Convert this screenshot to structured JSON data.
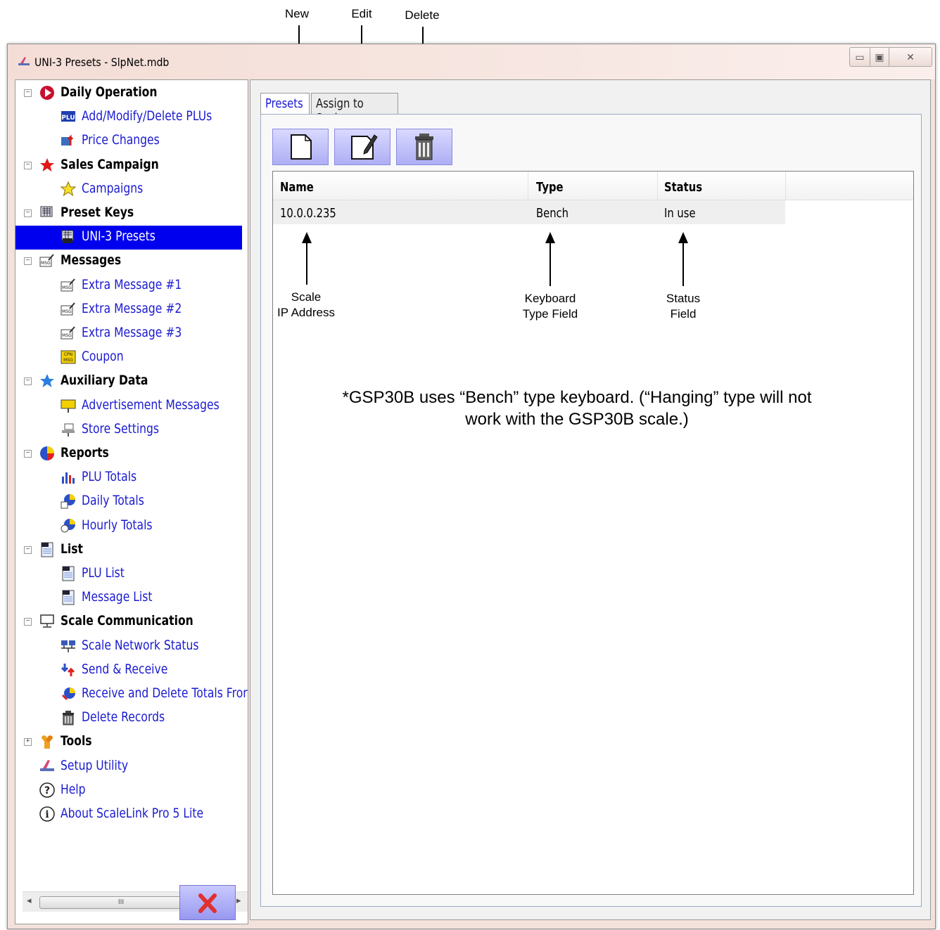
{
  "callouts": {
    "new": "New",
    "edit": "Edit",
    "delete": "Delete",
    "scale_ip_line1": "Scale",
    "scale_ip_line2": "IP Address",
    "keyboard_line1": "Keyboard",
    "keyboard_line2": "Type Field",
    "status_line1": "Status",
    "status_line2": "Field"
  },
  "window": {
    "title": "UNI-3 Presets - SlpNet.mdb",
    "min_glyph": "▭",
    "max_glyph": "▣",
    "close_glyph": "✕"
  },
  "tree": [
    {
      "level": 0,
      "label": "Daily Operation",
      "icon": "play-icon",
      "expander": "⊟"
    },
    {
      "level": 1,
      "label": "Add/Modify/Delete PLUs",
      "icon": "plu-icon"
    },
    {
      "level": 1,
      "label": "Price Changes",
      "icon": "price-change-icon"
    },
    {
      "level": 0,
      "label": "Sales Campaign",
      "icon": "star-red-icon",
      "expander": "⊟"
    },
    {
      "level": 1,
      "label": "Campaigns",
      "icon": "star-yellow-icon"
    },
    {
      "level": 0,
      "label": "Preset Keys",
      "icon": "preset-keys-icon",
      "expander": "⊟"
    },
    {
      "level": 1,
      "label": "UNI-3 Presets",
      "icon": "uni3-presets-icon",
      "selected": true
    },
    {
      "level": 0,
      "label": "Messages",
      "icon": "message-icon",
      "expander": "⊟"
    },
    {
      "level": 1,
      "label": "Extra Message #1",
      "icon": "message-icon"
    },
    {
      "level": 1,
      "label": "Extra Message #2",
      "icon": "message-icon"
    },
    {
      "level": 1,
      "label": "Extra Message #3",
      "icon": "message-icon"
    },
    {
      "level": 1,
      "label": "Coupon",
      "icon": "coupon-icon"
    },
    {
      "level": 0,
      "label": "Auxiliary Data",
      "icon": "star-blue-icon",
      "expander": "⊟"
    },
    {
      "level": 1,
      "label": "Advertisement Messages",
      "icon": "advertisement-icon"
    },
    {
      "level": 1,
      "label": "Store Settings",
      "icon": "store-settings-icon"
    },
    {
      "level": 0,
      "label": "Reports",
      "icon": "pie-chart-icon",
      "expander": "⊟"
    },
    {
      "level": 1,
      "label": "PLU Totals",
      "icon": "bar-chart-icon"
    },
    {
      "level": 1,
      "label": "Daily Totals",
      "icon": "daily-totals-icon"
    },
    {
      "level": 1,
      "label": "Hourly Totals",
      "icon": "hourly-totals-icon"
    },
    {
      "level": 0,
      "label": "List",
      "icon": "list-icon",
      "expander": "⊟"
    },
    {
      "level": 1,
      "label": "PLU List",
      "icon": "list-icon"
    },
    {
      "level": 1,
      "label": "Message List",
      "icon": "list-icon"
    },
    {
      "level": 0,
      "label": "Scale Communication",
      "icon": "monitor-icon",
      "expander": "⊟"
    },
    {
      "level": 1,
      "label": "Scale Network Status",
      "icon": "network-icon"
    },
    {
      "level": 1,
      "label": "Send & Receive",
      "icon": "send-receive-icon"
    },
    {
      "level": 1,
      "label": "Receive and Delete Totals Fror",
      "icon": "receive-delete-icon"
    },
    {
      "level": 1,
      "label": "Delete Records",
      "icon": "trash-icon"
    },
    {
      "level": 0,
      "label": "Tools",
      "icon": "tools-icon",
      "expander": "⊞"
    },
    {
      "level": 0,
      "label": "Setup Utility",
      "icon": "setup-utility-icon",
      "plain": true
    },
    {
      "level": 0,
      "label": "Help",
      "icon": "help-icon",
      "plain": true
    },
    {
      "level": 0,
      "label": "About ScaleLink Pro 5 Lite",
      "icon": "info-icon",
      "plain": true
    }
  ],
  "scroll": {
    "thumb_grip": "III",
    "left": "◂",
    "right": "▸"
  },
  "exit_glyph": "✕",
  "tabs": {
    "presets": "Presets",
    "assign": "Assign to Scales"
  },
  "grid": {
    "columns": [
      "Name",
      "Type",
      "Status"
    ],
    "rows": [
      [
        "10.0.0.235",
        "Bench",
        "In use"
      ]
    ]
  },
  "note": {
    "line1": "*GSP30B uses “Bench” type keyboard. (“Hanging” type will not",
    "line2": "work with the GSP30B scale.)"
  },
  "colors": {
    "selection": "#0000ee",
    "link_text": "#1a1ad0",
    "button_fill": "#aeaef5",
    "exit_x": "#e03030"
  }
}
